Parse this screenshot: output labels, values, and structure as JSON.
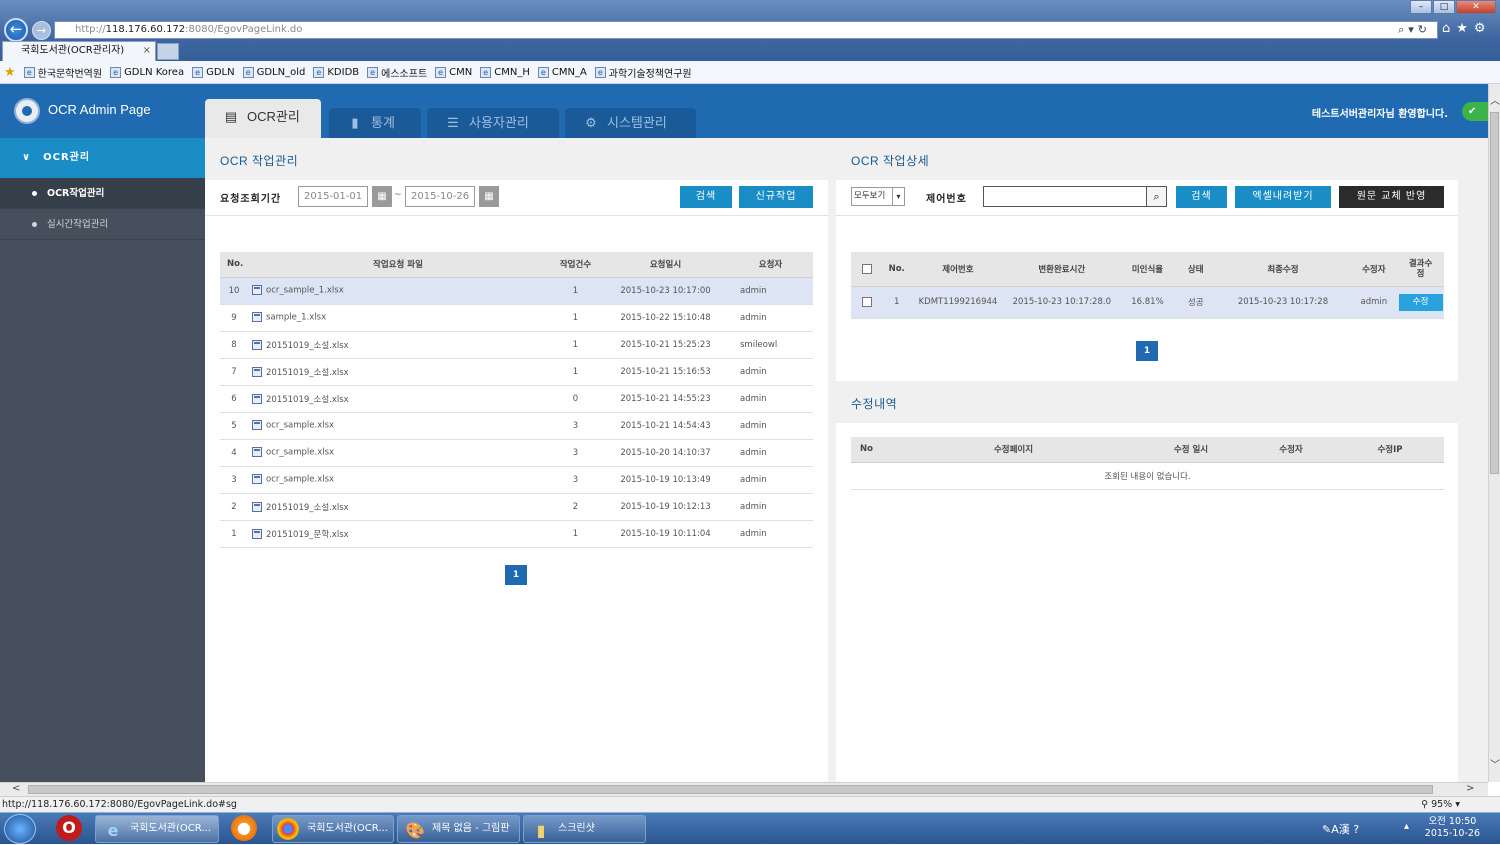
{
  "browser": {
    "url_prefix": "http://",
    "url_host": "118.176.60.172",
    "url_path": ":8080/EgovPageLink.do",
    "tab_title": "국회도서관(OCR관리자)",
    "tab_close": "×",
    "favorites": [
      "한국문학번역원",
      "GDLN Korea",
      "GDLN",
      "GDLN_old",
      "KDIDB",
      "에스소프트",
      "CMN",
      "CMN_H",
      "CMN_A",
      "과학기술정책연구원"
    ],
    "status_url": "http://118.176.60.172:8080/EgovPageLink.do#sg",
    "zoom": "95%"
  },
  "app": {
    "title": "OCR Admin Page",
    "welcome": "테스트서버관리자님 환영합니다.",
    "nav": [
      {
        "label": "OCR관리",
        "icon": "printer-icon"
      },
      {
        "label": "통계",
        "icon": "bar-chart-icon"
      },
      {
        "label": "사용자관리",
        "icon": "users-icon"
      },
      {
        "label": "시스템관리",
        "icon": "gear-icon"
      }
    ]
  },
  "sidebar": {
    "header": "OCR관리",
    "items": [
      {
        "label": "OCR작업관리",
        "active": true
      },
      {
        "label": "실시간작업관리",
        "active": false
      }
    ]
  },
  "jobs": {
    "title": "OCR 작업관리",
    "period_label": "요청조회기간",
    "date_from": "2015-01-01",
    "date_sep": "~",
    "date_to": "2015-10-26",
    "search_button": "검색",
    "new_button": "신규작업",
    "columns": [
      "No.",
      "작업요청 파일",
      "작업건수",
      "요청일시",
      "요청자"
    ],
    "rows": [
      {
        "no": "10",
        "file": "ocr_sample_1.xlsx",
        "count": "1",
        "date": "2015-10-23 10:17:00",
        "user": "admin",
        "selected": true
      },
      {
        "no": "9",
        "file": "sample_1.xlsx",
        "count": "1",
        "date": "2015-10-22 15:10:48",
        "user": "admin"
      },
      {
        "no": "8",
        "file": "20151019_소설.xlsx",
        "count": "1",
        "date": "2015-10-21 15:25:23",
        "user": "smileowl"
      },
      {
        "no": "7",
        "file": "20151019_소설.xlsx",
        "count": "1",
        "date": "2015-10-21 15:16:53",
        "user": "admin"
      },
      {
        "no": "6",
        "file": "20151019_소설.xlsx",
        "count": "0",
        "date": "2015-10-21 14:55:23",
        "user": "admin"
      },
      {
        "no": "5",
        "file": "ocr_sample.xlsx",
        "count": "3",
        "date": "2015-10-21 14:54:43",
        "user": "admin"
      },
      {
        "no": "4",
        "file": "ocr_sample.xlsx",
        "count": "3",
        "date": "2015-10-20 14:10:37",
        "user": "admin"
      },
      {
        "no": "3",
        "file": "ocr_sample.xlsx",
        "count": "3",
        "date": "2015-10-19 10:13:49",
        "user": "admin"
      },
      {
        "no": "2",
        "file": "20151019_소설.xlsx",
        "count": "2",
        "date": "2015-10-19 10:12:13",
        "user": "admin"
      },
      {
        "no": "1",
        "file": "20151019_문학.xlsx",
        "count": "1",
        "date": "2015-10-19 10:11:04",
        "user": "admin"
      }
    ],
    "page": "1"
  },
  "detail": {
    "title": "OCR 작업상세",
    "filter_value": "모두보기",
    "control_label": "제어번호",
    "control_value": "",
    "search_button": "검색",
    "excel_button": "엑셀내려받기",
    "replace_button": "원문 교체 반영",
    "columns": [
      "No.",
      "제어번호",
      "변환완료시간",
      "미인식율",
      "상태",
      "최종수정",
      "수정자",
      "결과수정"
    ],
    "rows": [
      {
        "no": "1",
        "control": "KDMT1199216944",
        "done": "2015-10-23 10:17:28.0",
        "rate": "16.81%",
        "status": "성공",
        "modified": "2015-10-23 10:17:28",
        "editor": "admin",
        "action": "수정"
      }
    ],
    "page": "1"
  },
  "history": {
    "title": "수정내역",
    "columns": [
      "No",
      "수정페이지",
      "수정 일시",
      "수정자",
      "수정IP"
    ],
    "empty_message": "조회된 내용이 없습니다."
  },
  "taskbar": {
    "items": [
      "국회도서관(OCR...",
      "국회도서관(OCR...",
      "제목 없음 - 그림판",
      "스크린샷"
    ],
    "clock_time": "오전 10:50",
    "clock_date": "2015-10-26"
  }
}
